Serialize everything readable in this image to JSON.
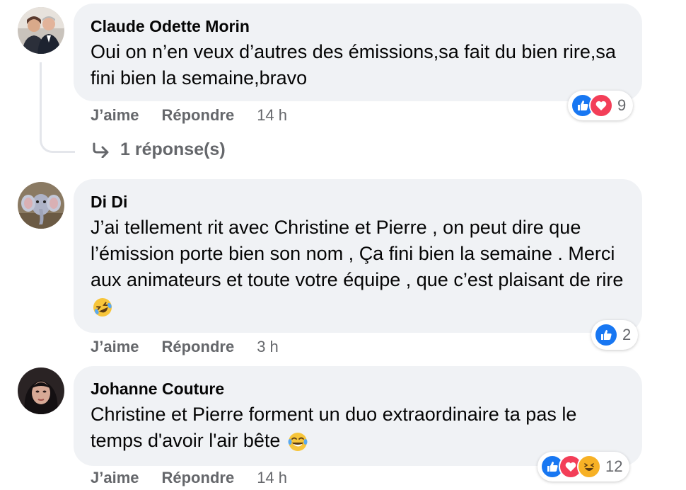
{
  "comments": [
    {
      "author": "Claude Odette Morin",
      "text": "Oui on n’en veux d’autres des émissions,sa fait du bien rire,sa fini bien la semaine,bravo",
      "like_label": "J’aime",
      "reply_label": "Répondre",
      "time": "14 h",
      "reactions": [
        "like",
        "love"
      ],
      "reaction_count": "9",
      "replies_link": "1 réponse(s)"
    },
    {
      "author": "Di Di",
      "text": "J’ai tellement rit avec Christine et Pierre , on peut dire que l’émission porte bien son nom , Ça fini bien la semaine . Merci aux animateurs et toute votre équipe , que c’est plaisant de rire",
      "text_emoji": "rolling-on-floor-laughing",
      "like_label": "J’aime",
      "reply_label": "Répondre",
      "time": "3 h",
      "reactions": [
        "like"
      ],
      "reaction_count": "2"
    },
    {
      "author": "Johanne Couture",
      "text": "Christine et Pierre forment un duo extraordinaire ta pas le temps d'avoir l'air bête",
      "text_emoji": "tears-of-joy",
      "like_label": "J’aime",
      "reply_label": "Répondre",
      "time": "14 h",
      "reactions": [
        "like",
        "love",
        "haha"
      ],
      "reaction_count": "12"
    }
  ],
  "colors": {
    "bubble": "#f0f2f5",
    "secondary_text": "#65676b",
    "like": "#1877f2",
    "love": "#f33e58",
    "haha": "#f7b125"
  }
}
